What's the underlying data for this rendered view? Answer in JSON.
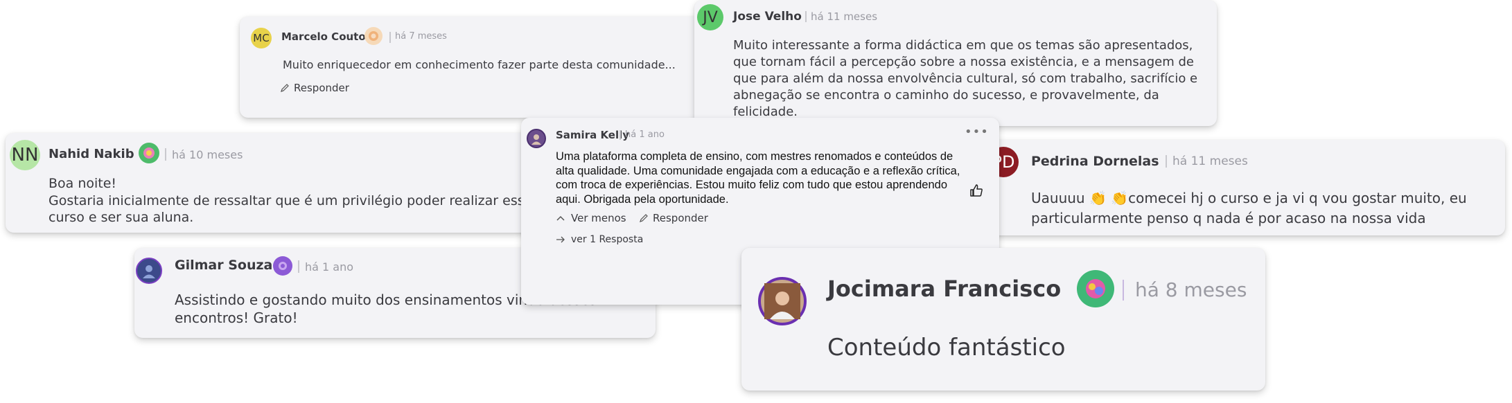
{
  "comments": {
    "marcelo": {
      "initials": "MC",
      "name": "Marcelo Couto",
      "time": "há 7 meses",
      "text": "Muito enriquecedor em conhecimento fazer parte desta comunidade...",
      "reply_label": "Responder",
      "avatar_color": "#e8d24a"
    },
    "jose": {
      "initials": "JV",
      "name": "Jose Velho",
      "time": "há 11 meses",
      "text": "Muito interessante a forma didáctica em que os temas são apresentados, que tornam fácil a percepção sobre a nossa existência, e a mensagem de que para além da nossa envolvência cultural,  só com trabalho, sacrifício e abnegação se encontra o caminho do sucesso, e provavelmente, da felicidade.",
      "avatar_color": "#5cc96a"
    },
    "nahid": {
      "initials": "NN",
      "name": "Nahid Nakib",
      "time": "há 10 meses",
      "text_line1": "Boa noite!",
      "text_line2": "Gostaria inicialmente de ressaltar que é um privilégio poder realizar esse curso e ser sua aluna.",
      "avatar_color": "#b6e6a6"
    },
    "samira": {
      "name": "Samira Kelly",
      "time": "há 1 ano",
      "text": "Uma plataforma completa de ensino, com mestres renomados e conteúdos de alta qualidade. Uma comunidade engajada com a educação e a reflexão crítica, com troca de experiências. Estou muito feliz com tudo que estou aprendendo aqui. Obrigada pela oportunidade.",
      "less_label": "Ver menos",
      "reply_label": "Responder",
      "replies_label": "ver 1 Resposta",
      "more_icon": "more-icon",
      "like_icon": "thumbs-up-icon"
    },
    "pedrina": {
      "initials": "PD",
      "name": "Pedrina Dornelas",
      "time": "há 11 meses",
      "text_a": "Uauuuu ",
      "emoji1": "👏",
      "emoji2": "👏",
      "text_b": "comecei hj o curso e ja vi q vou gostar muito, eu particularmente penso q nada é por acaso na nossa vida",
      "avatar_color": "#8c1c24"
    },
    "gilmar": {
      "name": "Gilmar Souza",
      "time": "há 1 ano",
      "text": "Assistindo e gostando muito dos ensinamentos vindo desses encontros! Grato!"
    },
    "jocimara": {
      "name": "Jocimara Francisco",
      "time": "há 8 meses",
      "text": "Conteúdo fantástico"
    }
  }
}
